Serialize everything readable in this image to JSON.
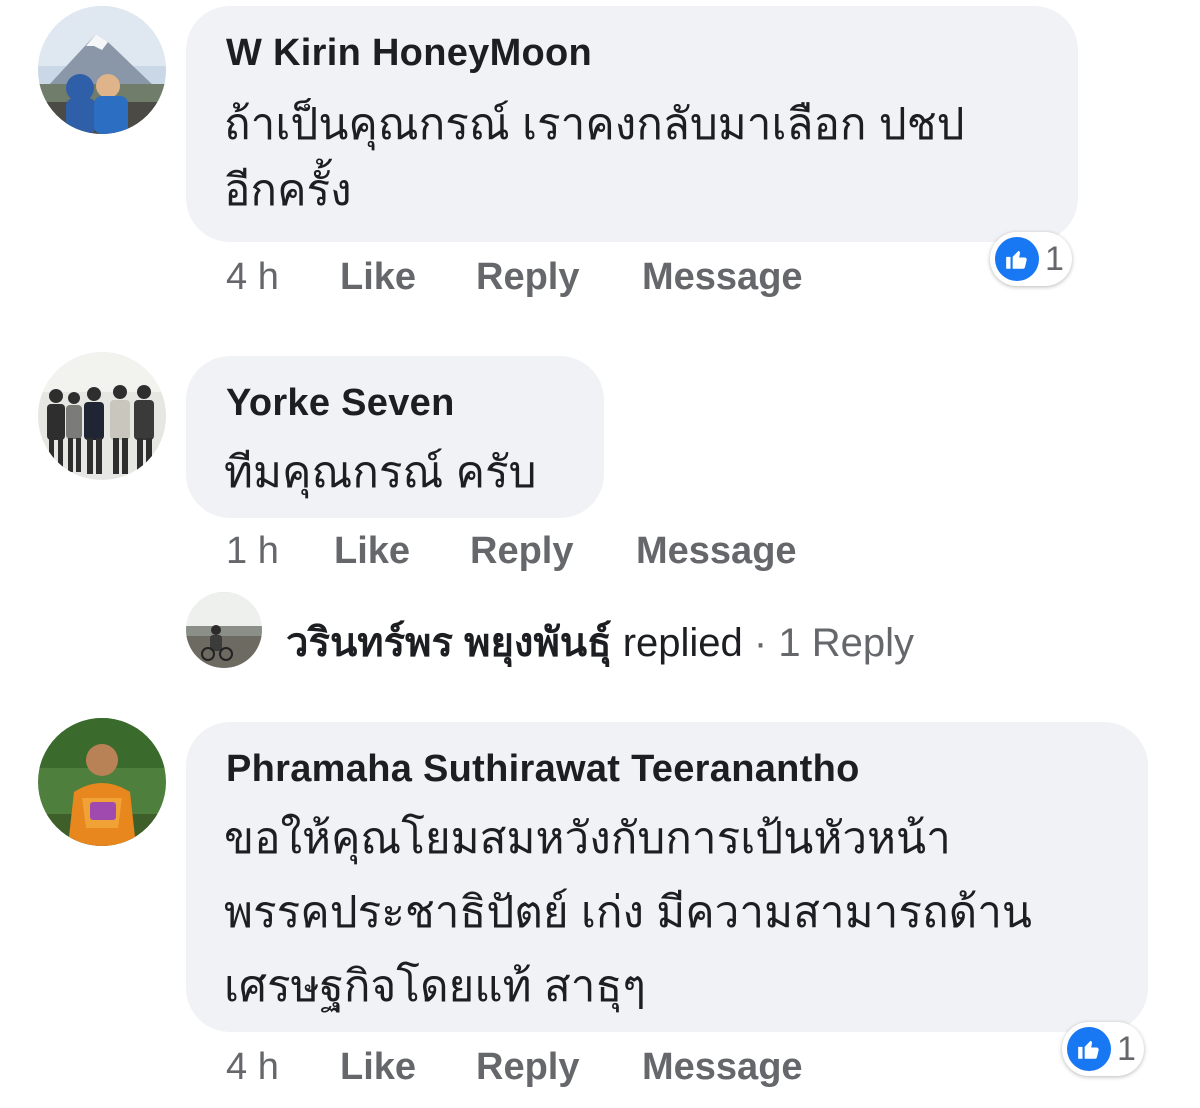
{
  "colors": {
    "bubble_bg": "#f0f2f5",
    "meta_text": "#65676b",
    "like_blue": "#1877f2"
  },
  "comments": [
    {
      "author": "W Kirin HoneyMoon",
      "lines": [
        "ถ้าเป็นคุณกรณ์ เราคงกลับมาเลือก ปชป",
        "อีกครั้ง"
      ],
      "time": "4 h",
      "like": "Like",
      "reply": "Reply",
      "message": "Message",
      "reaction_icon": "thumbs-up-icon",
      "reaction_count": "1"
    },
    {
      "author": "Yorke Seven",
      "lines": [
        "ทีมคุณกรณ์ ครับ"
      ],
      "time": "1 h",
      "like": "Like",
      "reply": "Reply",
      "message": "Message",
      "reply_summary": {
        "name": "วรินทร์พร พยุงพันธุ์",
        "verb": "replied",
        "separator": "·",
        "count": "1 Reply"
      }
    },
    {
      "author": "Phramaha Suthirawat Teeranantho",
      "lines": [
        "ขอให้คุณโยมสมหวังกับการเป้นหัวหน้า",
        "พรรคประชาธิปัตย์ เก่ง มีความสามารถด้าน",
        "เศรษฐกิจโดยแท้ สาธุๆ"
      ],
      "time": "4 h",
      "like": "Like",
      "reply": "Reply",
      "message": "Message",
      "reaction_icon": "thumbs-up-icon",
      "reaction_count": "1"
    }
  ]
}
